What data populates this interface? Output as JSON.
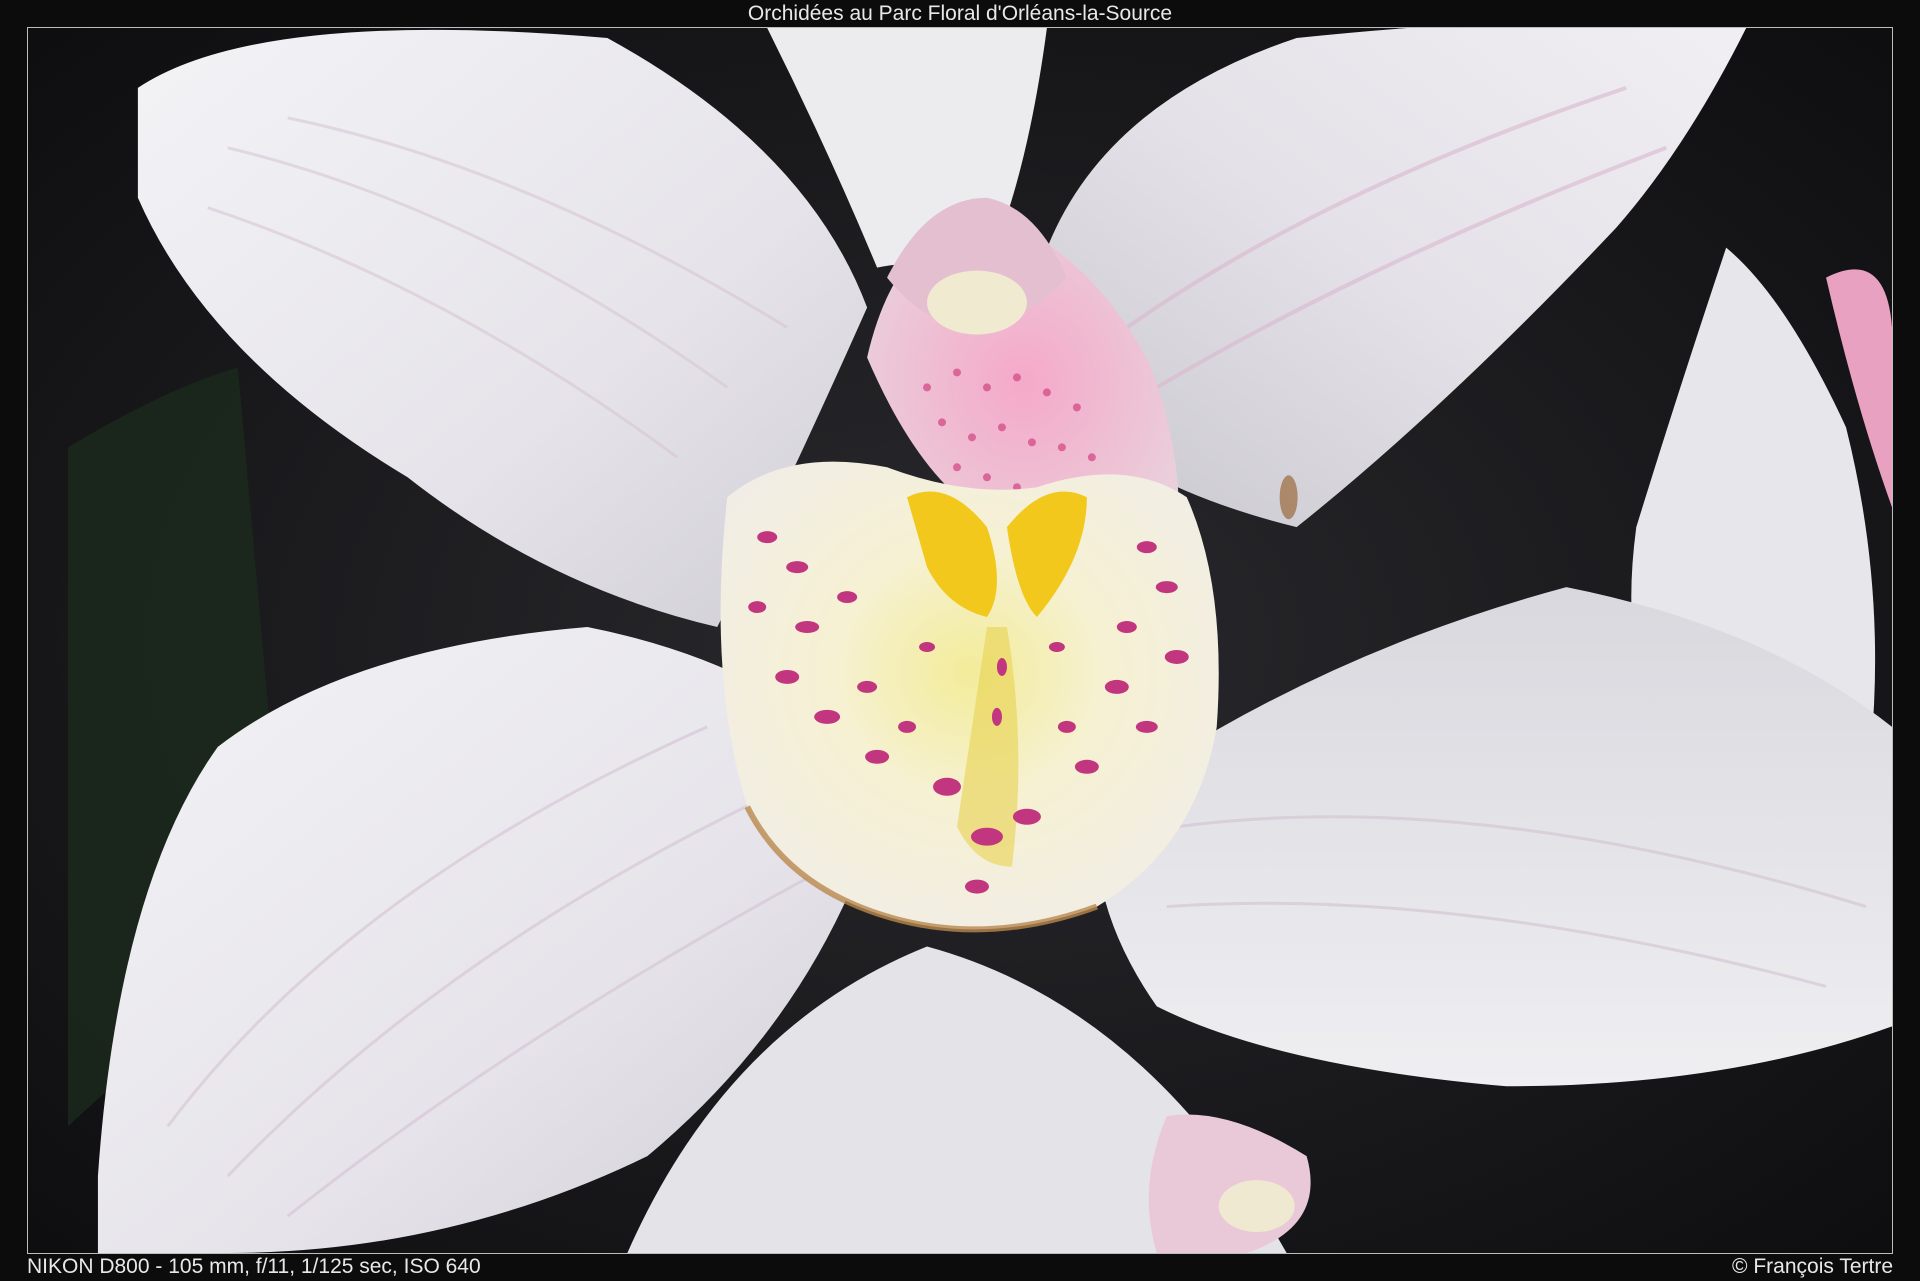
{
  "header": {
    "title": "Orchidées au Parc Floral d'Orléans-la-Source"
  },
  "footer": {
    "exif": "NIKON D800 - 105 mm, f/11, 1/125 sec, ISO 640",
    "credit": "© François Tertre"
  },
  "photo": {
    "subject": "white orchid with pink-spotted, yellow-throated lip",
    "colors": {
      "background": "#121214",
      "petal": "#e9e9ec",
      "petal_shadow": "#c9c8cf",
      "pink_spot": "#c2367f",
      "yellow": "#f2c81c",
      "border": "#bdbdbd"
    }
  }
}
